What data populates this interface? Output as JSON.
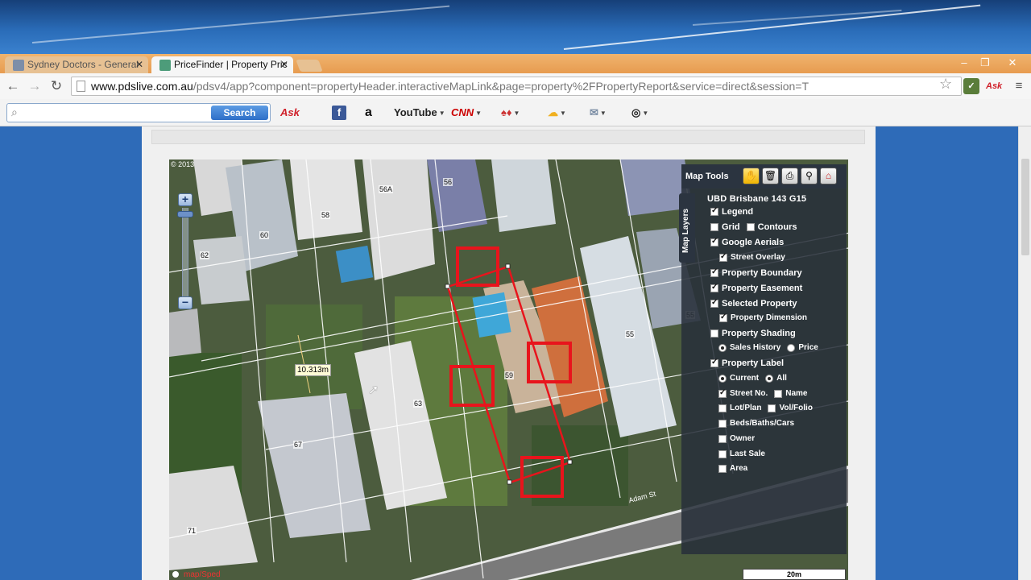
{
  "browser": {
    "tabs": [
      {
        "label": "Sydney Doctors - General",
        "active": false
      },
      {
        "label": "PriceFinder | Property Pric",
        "active": true
      }
    ],
    "tab_close": "✕",
    "url_host": "www.pdslive.com.au",
    "url_path": "/pdsv4/app?component=propertyHeader.interactiveMapLink&page=property%2FPropertyReport&service=direct&session=T",
    "window_controls": {
      "minimize": "–",
      "restore": "❐",
      "close": "✕"
    }
  },
  "toolbar": {
    "search_placeholder": "",
    "search_button": "Search",
    "items": [
      "Ask",
      "f",
      "a",
      "YouTube",
      "CNN"
    ]
  },
  "map": {
    "copyright": "© 2013",
    "lot_numbers": [
      "56A",
      "56",
      "58",
      "60",
      "62",
      "55",
      "59",
      "63",
      "67",
      "71",
      "55"
    ],
    "measurement": "10.313m",
    "street_name": "Adam St",
    "scale_label": "20m",
    "source_label": "map/Sped",
    "tools": {
      "title": "Map Tools",
      "layers_tab": "Map Layers",
      "map_ref": "UBD Brisbane 143 G15"
    },
    "layers": {
      "legend": "Legend",
      "grid": "Grid",
      "contours": "Contours",
      "google_aerials": "Google Aerials",
      "street_overlay": "Street Overlay",
      "property_boundary": "Property Boundary",
      "property_easement": "Property Easement",
      "selected_property": "Selected Property",
      "property_dimension": "Property Dimension",
      "property_shading": "Property Shading",
      "sales_history": "Sales History",
      "price": "Price",
      "property_label": "Property Label",
      "current": "Current",
      "all": "All",
      "street_no": "Street No.",
      "name": "Name",
      "lot_plan": "Lot/Plan",
      "vol_folio": "Vol/Folio",
      "beds_baths_cars": "Beds/Baths/Cars",
      "owner": "Owner",
      "last_sale": "Last Sale",
      "area": "Area"
    }
  },
  "colors": {
    "accent": "#2e6fc8",
    "selection_red": "#e8141c",
    "panel_bg": "#28303a"
  }
}
